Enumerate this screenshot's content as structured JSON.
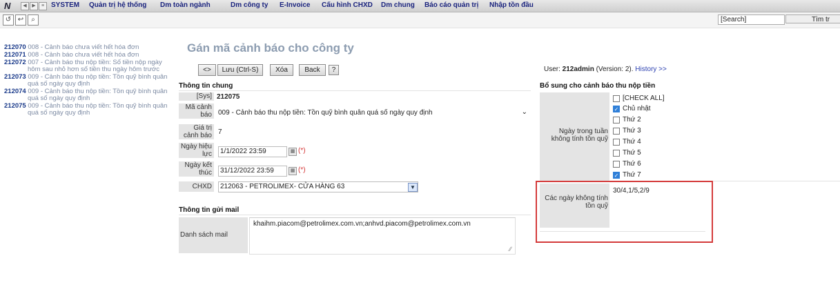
{
  "menu": {
    "logo": "N",
    "items": [
      "SYSTEM",
      "Quản trị hệ thống",
      "Dm toàn ngành",
      "Dm công ty",
      "E-Invoice",
      "Cấu hình CHXD",
      "Dm chung",
      "Báo cáo quản trị",
      "Nhập tồn đầu"
    ]
  },
  "toolbar": {
    "search_placeholder": "[Search]",
    "search_button": "Tìm tr"
  },
  "sidebar": {
    "items": [
      {
        "code": "212070",
        "text": "008 - Cảnh báo chưa viết hết hóa đơn"
      },
      {
        "code": "212071",
        "text": "008 - Cảnh báo chưa viết hết hóa đơn"
      },
      {
        "code": "212072",
        "text": "007 - Cảnh báo thu nộp tiền: Số tiền nộp ngày",
        "text2": "hôm sau nhỏ hơn số tiền thu ngày hôm trước"
      },
      {
        "code": "212073",
        "text": "009 - Cảnh báo thu nộp tiền: Tồn quỹ bình quân",
        "text2": "quá số ngày quy định"
      },
      {
        "code": "212074",
        "text": "009 - Cảnh báo thu nộp tiền: Tồn quỹ bình quân",
        "text2": "quá số ngày quy định"
      },
      {
        "code": "212075",
        "text": "009 - Cảnh báo thu nộp tiền: Tồn quỹ bình quân",
        "text2": "quá số ngày quy định"
      }
    ]
  },
  "page": {
    "title": "Gán mã cảnh báo cho công ty",
    "buttons": {
      "toggle": "<>",
      "save": "Lưu (Ctrl-S)",
      "delete": "Xóa",
      "back": "Back",
      "help": "?"
    },
    "user_prefix": "User: ",
    "user": "212admin",
    "version_text": " (Version: 2). ",
    "history": "History >>"
  },
  "general": {
    "heading": "Thông tin chung",
    "sys_label": "[Sys]",
    "sys_value": "212075",
    "code_label": "Mã cảnh báo",
    "code_value": "009 - Cảnh báo thu nộp tiền: Tồn quỹ bình quân quá số ngày quy định",
    "warn_label": "Giá trị cảnh báo",
    "warn_value": "7",
    "start_label": "Ngày hiệu lực",
    "start_value": "1/1/2022 23:59",
    "end_label": "Ngày kết thúc",
    "end_value": "31/12/2022 23:59",
    "required_mark": "(*)",
    "chxd_label": "CHXD",
    "chxd_value": "212063 - PETROLIMEX- CỬA HÀNG 63"
  },
  "mail": {
    "heading": "Thông tin gửi mail",
    "list_label": "Danh sách mail",
    "list_value": "khaihm.piacom@petrolimex.com.vn;anhvd.piacom@petrolimex.com.vn"
  },
  "extra": {
    "heading": "Bổ sung cho cảnh báo thu nộp tiền",
    "weekday_label": "Ngày trong tuần không tính tồn quỹ",
    "weekdays": [
      {
        "label": "[CHECK ALL]",
        "checked": false
      },
      {
        "label": "Chủ nhật",
        "checked": true
      },
      {
        "label": "Thứ 2",
        "checked": false
      },
      {
        "label": "Thứ 3",
        "checked": false
      },
      {
        "label": "Thứ 4",
        "checked": false
      },
      {
        "label": "Thứ 5",
        "checked": false
      },
      {
        "label": "Thứ 6",
        "checked": false
      },
      {
        "label": "Thứ 7",
        "checked": true
      }
    ],
    "exclude_label": "Các ngày không tính tồn quỹ",
    "exclude_value": "30/4,1/5,2/9"
  }
}
